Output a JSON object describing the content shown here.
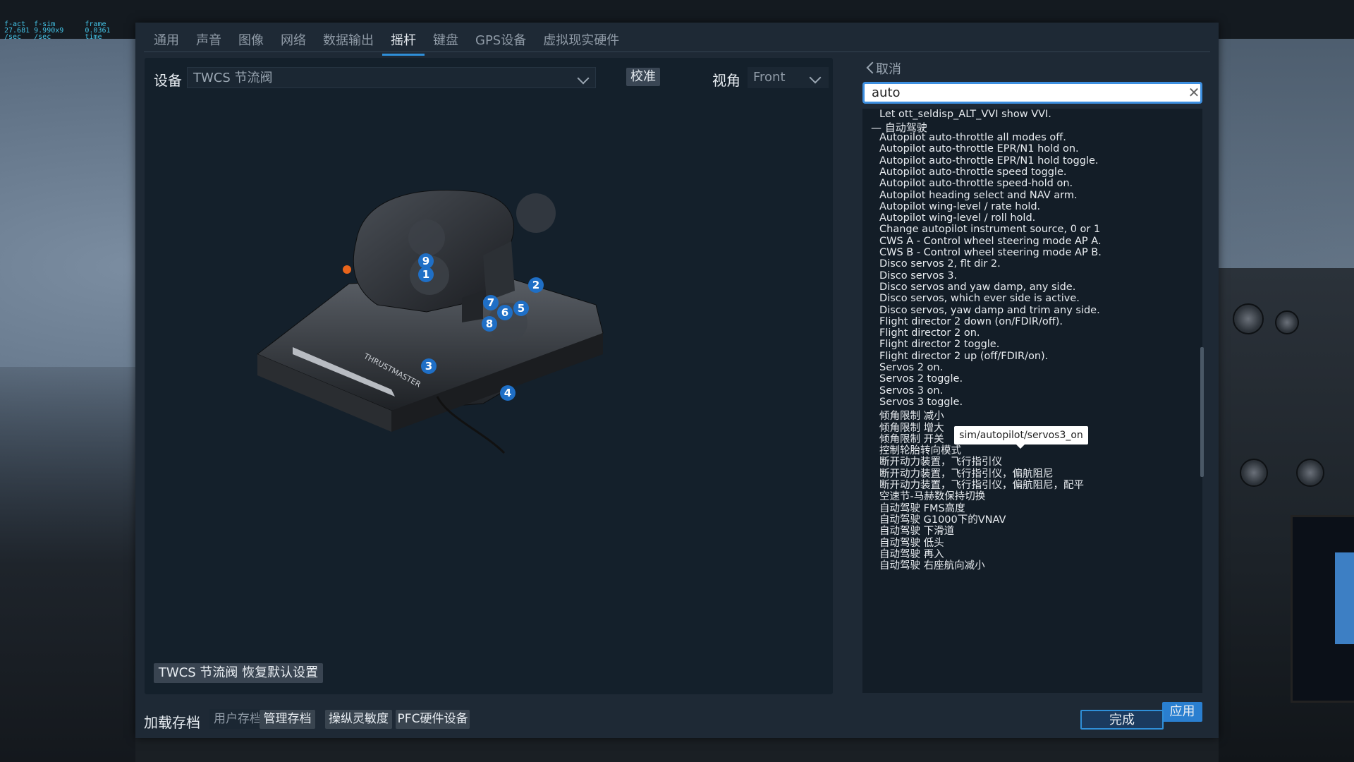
{
  "fsim_overlay": {
    "line1": "f-act  f-sim       frame",
    "line2": "27.681 9.990x9     0.0361",
    "line3": "/sec   /sec        time"
  },
  "tabs": [
    "通用",
    "声音",
    "图像",
    "网络",
    "数据输出",
    "摇杆",
    "键盘",
    "GPS设备",
    "虚拟现实硬件"
  ],
  "active_tab": "摇杆",
  "device": {
    "label": "设备",
    "selected": "TWCS 节流阀",
    "calibrate_label": "校准",
    "view_label": "视角",
    "view_value": "Front",
    "reset_label": "TWCS 节流阀 恢复默认设置"
  },
  "throttle_markers": [
    "1",
    "2",
    "3",
    "4",
    "5",
    "6",
    "7",
    "8",
    "9"
  ],
  "brand_text": "THRUSTMASTER",
  "search": {
    "cancel_label": "取消",
    "query": "auto"
  },
  "command_list": {
    "top_item": "Let ott_seldisp_ALT_VVI show VVI.",
    "group": "自动驾驶",
    "items": [
      "Autopilot auto-throttle all modes off.",
      "Autopilot auto-throttle EPR/N1 hold on.",
      "Autopilot auto-throttle EPR/N1 hold toggle.",
      "Autopilot auto-throttle speed toggle.",
      "Autopilot auto-throttle speed-hold on.",
      "Autopilot heading select and NAV arm.",
      "Autopilot wing-level / rate hold.",
      "Autopilot wing-level / roll hold.",
      "Change autopilot instrument source, 0 or 1",
      "CWS A - Control wheel steering mode AP A.",
      "CWS B - Control wheel steering mode AP B.",
      "Disco servos 2, flt dir 2.",
      "Disco servos 3.",
      "Disco servos and yaw damp, any side.",
      "Disco servos, which ever side is active.",
      "Disco servos, yaw damp and trim any side.",
      "Flight director 2 down (on/FDIR/off).",
      "Flight director 2 on.",
      "Flight director 2 toggle.",
      "Flight director 2 up (off/FDIR/on).",
      "Servos 2 on.",
      "Servos 2 toggle.",
      "Servos 3 on.",
      "Servos 3 toggle.",
      "倾角限制 减小",
      "倾角限制 增大",
      "倾角限制 开关",
      "控制轮胎转向模式",
      "断开动力装置，飞行指引仪",
      "断开动力装置，飞行指引仪，偏航阻尼",
      "断开动力装置，飞行指引仪，偏航阻尼，配平",
      "空速节-马赫数保持切换",
      "自动驾驶 FMS高度",
      "自动驾驶 G1000下的VNAV",
      "自动驾驶 下滑道",
      "自动驾驶 低头",
      "自动驾驶 再入",
      "自动驾驶 右座航向减小"
    ],
    "tooltip": "sim/autopilot/servos3_on"
  },
  "apply_label": "应用",
  "bottom": {
    "load_label": "加载存档",
    "profile_value": "用户存档",
    "manage_label": "管理存档",
    "sensitivity_label": "操纵灵敏度",
    "pfc_label": "PFC硬件设备",
    "done_label": "完成"
  },
  "colors": {
    "accent": "#2f8fd8",
    "dialog_bg": "#1e2935",
    "panel_bg": "#14202b",
    "marker": "#1f6fc6"
  }
}
